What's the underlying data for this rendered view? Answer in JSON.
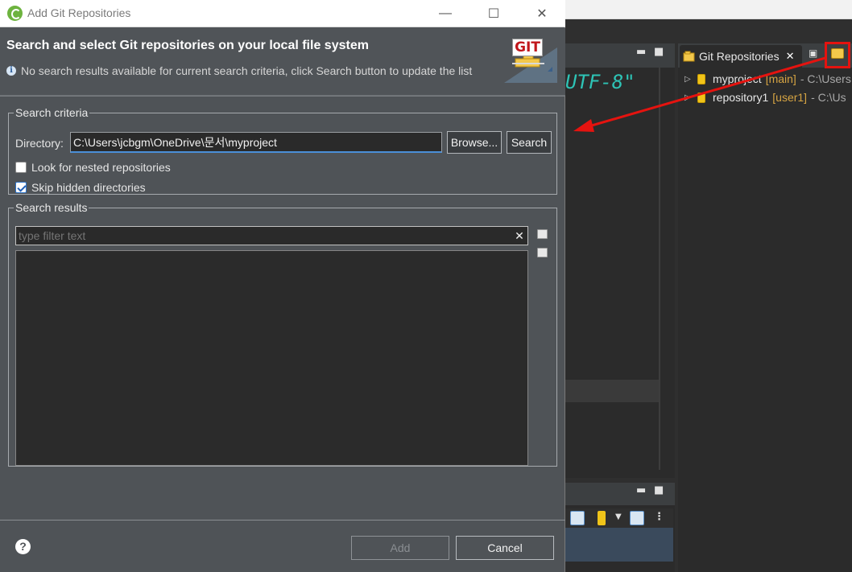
{
  "dialog": {
    "window_title": "Add Git Repositories",
    "header_title": "Search and select Git repositories on your local file system",
    "info_message": "No search results available for current search criteria, click Search button to update the list",
    "banner_logo_text": "GIT",
    "search_criteria": {
      "legend": "Search criteria",
      "directory_label": "Directory:",
      "directory_value": "C:\\Users\\jcbgm\\OneDrive\\문서\\myproject",
      "browse_label": "Browse...",
      "search_label": "Search",
      "nested_label": "Look for nested repositories",
      "nested_checked": false,
      "skip_hidden_label": "Skip hidden directories",
      "skip_hidden_checked": true
    },
    "search_results": {
      "legend": "Search results",
      "filter_placeholder": "type filter text",
      "items": []
    },
    "buttons": {
      "add_label": "Add",
      "cancel_label": "Cancel",
      "help_glyph": "?"
    }
  },
  "ide": {
    "editor_visible_text": "UTF-8\"",
    "git_view": {
      "tab_title": "Git Repositories",
      "repositories": [
        {
          "name": "myproject",
          "branch": "[main]",
          "path": "- C:\\Users"
        },
        {
          "name": "repository1",
          "branch": "[user1]",
          "path": "- C:\\Us"
        }
      ]
    }
  },
  "icons": {
    "app": "spring-tool-suite-icon",
    "info": "info-icon",
    "help": "help-icon",
    "add_repo": "add-existing-repository-icon",
    "repo": "git-repository-icon"
  },
  "colors": {
    "annotation_red": "#e5130f",
    "dialog_bg": "#4f5357",
    "focus_blue": "#4a8fd8",
    "branch_label": "#d6a443",
    "editor_string": "#2ec4b6"
  }
}
